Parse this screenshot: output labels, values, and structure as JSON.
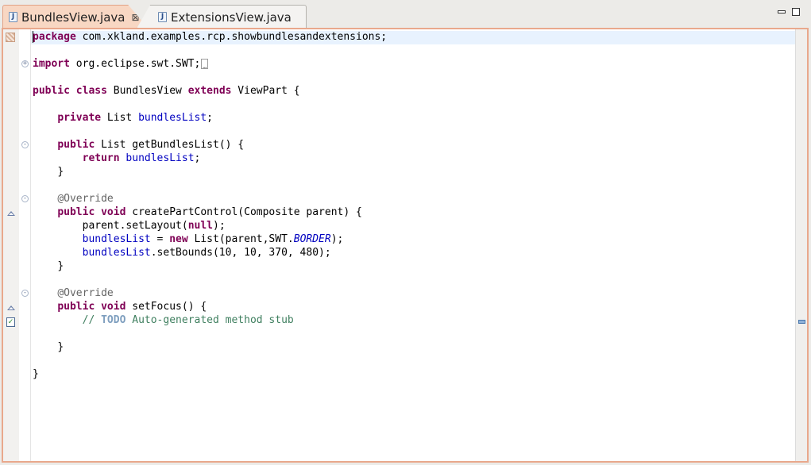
{
  "tabs": [
    {
      "label": "BundlesView.java",
      "icon": "java-file-icon",
      "active": true,
      "close": "⊠"
    },
    {
      "label": "ExtensionsView.java",
      "icon": "java-file-icon",
      "active": false
    }
  ],
  "window_controls": [
    "minimize-icon",
    "maximize-icon"
  ],
  "code": {
    "package_kw": "package",
    "package_name": " com.xkland.examples.rcp.showbundlesandextensions;",
    "import_kw": "import",
    "import_name": " org.eclipse.swt.SWT;",
    "public": "public",
    "class": "class",
    "class_name": " BundlesView ",
    "extends": "extends",
    "superclass": " ViewPart {",
    "private": "private",
    "list_type": " List ",
    "field": "bundlesList",
    "semicolon": ";",
    "getter_sig": " List getBundlesList() {",
    "return": "return",
    "close_brace": "}",
    "override": "@Override",
    "void": "void",
    "create_sig": " createPartControl(Composite parent) {",
    "set_layout_a": "parent.setLayout(",
    "null": "null",
    "set_layout_b": ");",
    "assign_a": " = ",
    "new": "new",
    "assign_b": " List(parent,SWT.",
    "border": "BORDER",
    "assign_c": ");",
    "set_bounds": ".setBounds(10, 10, 370, 480);",
    "focus_sig": " setFocus() {",
    "comment_a": "// ",
    "todo": "TODO",
    "comment_b": " Auto-generated method stub"
  },
  "colors": {
    "keyword": "#7f0055",
    "field": "#0000c0",
    "annotation": "#646464",
    "comment": "#3f7f5f",
    "active_tab": "#f8d7c3",
    "editor_border": "#e9a88c"
  }
}
